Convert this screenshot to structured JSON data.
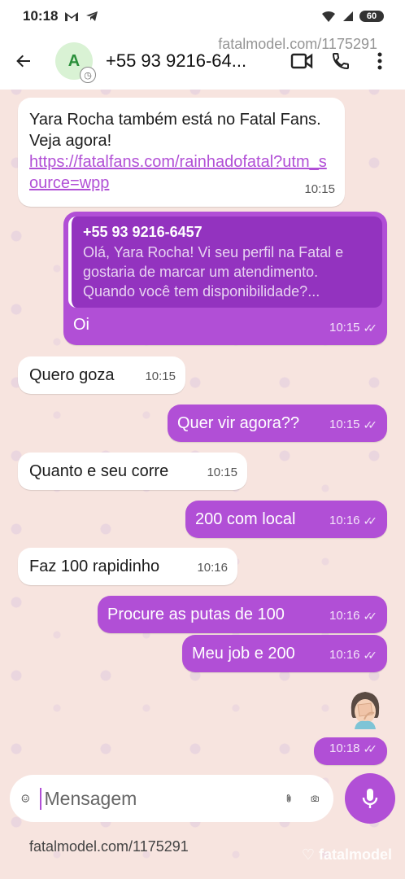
{
  "status_bar": {
    "time": "10:18",
    "battery": "60"
  },
  "header": {
    "back_icon": "arrow-left-icon",
    "avatar_initial": "A",
    "contact_name": "+55 93 9216-64...",
    "icons": [
      "video-call-icon",
      "phone-icon",
      "more-vert-icon"
    ]
  },
  "watermark": "fatalmodel.com/1175291",
  "messages": [
    {
      "dir": "in",
      "text": "Yara Rocha também está no Fatal Fans. Veja agora!",
      "link": "https://fatalfans.com/rainhadofatal?utm_source=wpp",
      "time": "10:15"
    },
    {
      "dir": "out",
      "quote_name": "+55 93 9216-6457",
      "quote_text": "Olá, Yara Rocha! Vi seu perfil na Fatal e gostaria de marcar um atendimento. Quando você tem disponibilidade?...",
      "text": "Oi",
      "time": "10:15"
    },
    {
      "dir": "in",
      "text": "Quero goza",
      "time": "10:15"
    },
    {
      "dir": "out",
      "text": "Quer vir agora??",
      "time": "10:15"
    },
    {
      "dir": "in",
      "text": "Quanto e seu corre",
      "time": "10:15"
    },
    {
      "dir": "out",
      "text": "200 com local",
      "time": "10:16"
    },
    {
      "dir": "in",
      "text": "Faz 100 rapidinho",
      "time": "10:16"
    },
    {
      "dir": "out",
      "text": "Procure as putas de 100",
      "time": "10:16"
    },
    {
      "dir": "out",
      "text": "Meu job e 200",
      "time": "10:16"
    },
    {
      "dir": "out",
      "emoji": "face-palm-emoji",
      "time": "10:18"
    }
  ],
  "composer": {
    "placeholder": "Mensagem",
    "icons": [
      "sticker-icon",
      "attach-icon",
      "camera-icon",
      "mic-icon"
    ]
  },
  "footer": {
    "watermark": "fatalmodel.com/1175291",
    "brand": "fatalmodel"
  },
  "colors": {
    "accent": "#b14fd6",
    "background": "#f7e4df"
  }
}
